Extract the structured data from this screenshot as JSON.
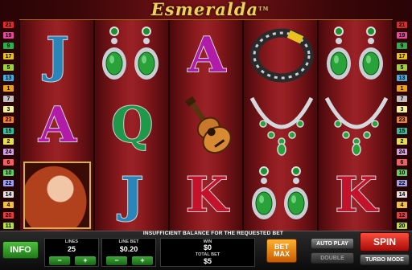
{
  "game": {
    "title": "Esmeralda",
    "trademark": "TM"
  },
  "paylines": {
    "left": [
      {
        "n": "21",
        "color": "#e02a2a"
      },
      {
        "n": "19",
        "color": "#e24a9a"
      },
      {
        "n": "9",
        "color": "#2ab04a"
      },
      {
        "n": "17",
        "color": "#e8c020"
      },
      {
        "n": "5",
        "color": "#a0d040"
      },
      {
        "n": "13",
        "color": "#40b0e0"
      },
      {
        "n": "1",
        "color": "#e8a020"
      },
      {
        "n": "7",
        "color": "#c0c0c0"
      },
      {
        "n": "3",
        "color": "#f0f0a0"
      },
      {
        "n": "23",
        "color": "#f08030"
      },
      {
        "n": "15",
        "color": "#30c0a0"
      },
      {
        "n": "2",
        "color": "#e0e050"
      },
      {
        "n": "24",
        "color": "#d0a0e0"
      },
      {
        "n": "6",
        "color": "#f06060"
      },
      {
        "n": "10",
        "color": "#60d060"
      },
      {
        "n": "22",
        "color": "#a0a0f0"
      },
      {
        "n": "14",
        "color": "#e0e0e0"
      },
      {
        "n": "4",
        "color": "#f0c040"
      },
      {
        "n": "20",
        "color": "#e04040"
      },
      {
        "n": "11",
        "color": "#b0e040"
      }
    ],
    "right": [
      {
        "n": "21",
        "color": "#e02a2a"
      },
      {
        "n": "19",
        "color": "#e24a9a"
      },
      {
        "n": "9",
        "color": "#2ab04a"
      },
      {
        "n": "17",
        "color": "#e8c020"
      },
      {
        "n": "5",
        "color": "#a0d040"
      },
      {
        "n": "13",
        "color": "#40b0e0"
      },
      {
        "n": "1",
        "color": "#e8a020"
      },
      {
        "n": "7",
        "color": "#c0c0c0"
      },
      {
        "n": "3",
        "color": "#f0f0a0"
      },
      {
        "n": "23",
        "color": "#f08030"
      },
      {
        "n": "15",
        "color": "#30c0a0"
      },
      {
        "n": "2",
        "color": "#e0e050"
      },
      {
        "n": "24",
        "color": "#d0a0e0"
      },
      {
        "n": "6",
        "color": "#f06060"
      },
      {
        "n": "10",
        "color": "#60d060"
      },
      {
        "n": "22",
        "color": "#a0a0f0"
      },
      {
        "n": "14",
        "color": "#e0e0e0"
      },
      {
        "n": "4",
        "color": "#f0c040"
      },
      {
        "n": "12",
        "color": "#e04040"
      },
      {
        "n": "20",
        "color": "#b0e040"
      }
    ]
  },
  "reels": [
    [
      "J",
      "A",
      "portrait"
    ],
    [
      "earrings",
      "Q",
      "J"
    ],
    [
      "A",
      "guitar",
      "K"
    ],
    [
      "bracelet",
      "necklace",
      "earrings"
    ],
    [
      "earrings",
      "necklace",
      "K"
    ]
  ],
  "message": "INSUFFICIENT BALANCE FOR THE REQUESTED BET",
  "controls": {
    "info_label": "INFO",
    "lines_label": "LINES",
    "lines_value": "25",
    "linebet_label": "LINE BET",
    "linebet_value": "$0.20",
    "win_label": "WIN",
    "win_value": "$0",
    "totalbet_label": "TOTAL BET",
    "totalbet_value": "$5",
    "minus": "−",
    "plus": "+",
    "betmax_line1": "BET",
    "betmax_line2": "MAX",
    "autoplay_label": "AUTO PLAY",
    "double_label": "DOUBLE",
    "spin_label": "SPIN",
    "turbo_label": "TURBO MODE"
  }
}
